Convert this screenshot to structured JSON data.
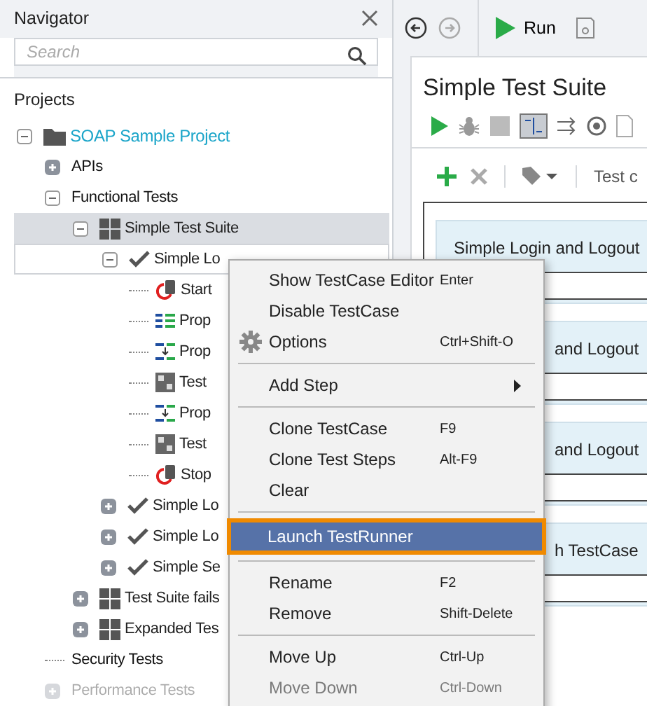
{
  "navigator": {
    "title": "Navigator",
    "search": {
      "placeholder": "Search"
    },
    "root_label": "Projects",
    "tree": [
      {
        "label": "SOAP Sample Project",
        "kind": "project",
        "expanded": true,
        "selected": false,
        "children": [
          {
            "label": "APIs",
            "kind": "group",
            "expanded": false,
            "selected": false
          },
          {
            "label": "Functional Tests",
            "kind": "group",
            "expanded": true,
            "selected": false,
            "children": [
              {
                "label": "Simple Test Suite",
                "kind": "suite",
                "expanded": true,
                "selected": true,
                "children": [
                  {
                    "label": "Simple Lo",
                    "kind": "testcase",
                    "expanded": true,
                    "selected": false,
                    "focused": true,
                    "children": [
                      {
                        "label": "Start",
                        "kind": "start",
                        "selected": false
                      },
                      {
                        "label": "Prop",
                        "kind": "properties",
                        "selected": false
                      },
                      {
                        "label": "Prop",
                        "kind": "transfer",
                        "selected": false
                      },
                      {
                        "label": "Test",
                        "kind": "soap",
                        "selected": false
                      },
                      {
                        "label": "Prop",
                        "kind": "transfer",
                        "selected": false
                      },
                      {
                        "label": "Test",
                        "kind": "soap",
                        "selected": false
                      },
                      {
                        "label": "Stop",
                        "kind": "start",
                        "selected": false
                      }
                    ]
                  },
                  {
                    "label": "Simple Lo",
                    "kind": "testcase",
                    "expanded": false,
                    "selected": false
                  },
                  {
                    "label": "Simple Lo",
                    "kind": "testcase",
                    "expanded": false,
                    "selected": false
                  },
                  {
                    "label": "Simple Se",
                    "kind": "testcase",
                    "expanded": false,
                    "selected": false
                  }
                ]
              },
              {
                "label": "Test Suite fails",
                "kind": "suite",
                "expanded": false,
                "selected": false
              },
              {
                "label": "Expanded Tes",
                "kind": "suite",
                "expanded": false,
                "selected": false
              }
            ]
          },
          {
            "label": "Security Tests",
            "kind": "group",
            "selected": false
          },
          {
            "label": "Performance Tests",
            "kind": "group",
            "expanded": false,
            "selected": false
          }
        ]
      }
    ]
  },
  "toolbar": {
    "run_label": "Run"
  },
  "editor": {
    "title": "Simple Test Suite",
    "filter_label": "Test c",
    "cards": [
      {
        "label": "Simple Login and Logout"
      },
      {
        "label": "and Logout"
      },
      {
        "label": "and Logout"
      },
      {
        "label": "h TestCase"
      }
    ]
  },
  "context_menu": [
    {
      "kind": "item",
      "label": "Show TestCase Editor",
      "shortcut": "Enter",
      "selected": false,
      "disabled": false
    },
    {
      "kind": "item",
      "label": "Disable TestCase",
      "selected": false,
      "disabled": false
    },
    {
      "kind": "settings",
      "label": "Options",
      "shortcut": "Ctrl+Shift-O",
      "selected": false,
      "disabled": false
    },
    {
      "kind": "separator"
    },
    {
      "kind": "submenu",
      "label": "Add Step",
      "selected": false,
      "disabled": false
    },
    {
      "kind": "separator"
    },
    {
      "kind": "item",
      "label": "Clone TestCase",
      "shortcut": "F9",
      "selected": false,
      "disabled": false
    },
    {
      "kind": "item",
      "label": "Clone Test Steps",
      "shortcut": "Alt-F9",
      "selected": false,
      "disabled": false
    },
    {
      "kind": "item",
      "label": "Clear",
      "selected": false,
      "disabled": false
    },
    {
      "kind": "separator"
    },
    {
      "kind": "item",
      "label": "Launch TestRunner",
      "selected": true,
      "disabled": false
    },
    {
      "kind": "separator"
    },
    {
      "kind": "item",
      "label": "Rename",
      "shortcut": "F2",
      "selected": false,
      "disabled": false
    },
    {
      "kind": "item",
      "label": "Remove",
      "shortcut": "Shift-Delete",
      "selected": false,
      "disabled": false
    },
    {
      "kind": "separator"
    },
    {
      "kind": "item",
      "label": "Move Up",
      "shortcut": "Ctrl-Up",
      "selected": false,
      "disabled": false
    },
    {
      "kind": "item",
      "label": "Move Down",
      "shortcut": "Ctrl-Down",
      "selected": false,
      "disabled": true
    }
  ]
}
